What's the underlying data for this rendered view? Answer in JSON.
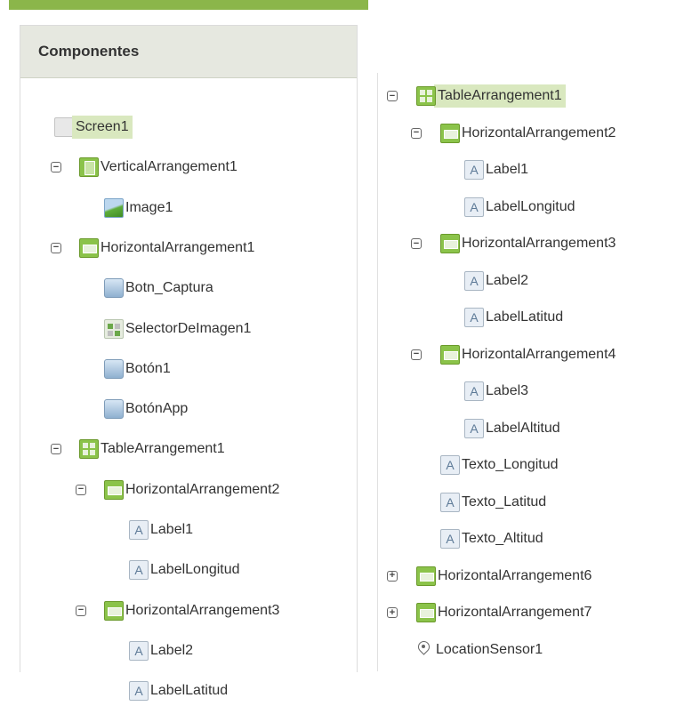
{
  "header": {
    "title": "Componentes"
  },
  "left_tree": [
    {
      "label": "Screen1",
      "icon": "screen-icon",
      "indent": 0,
      "toggle": "",
      "selected": true
    },
    {
      "label": "VerticalArrangement1",
      "icon": "vertical-arrangement-icon",
      "indent": 1,
      "toggle": "−"
    },
    {
      "label": "Image1",
      "icon": "image-icon",
      "indent": 2,
      "toggle": ""
    },
    {
      "label": "HorizontalArrangement1",
      "icon": "horizontal-arrangement-icon",
      "indent": 1,
      "toggle": "−"
    },
    {
      "label": "Botn_Captura",
      "icon": "button-icon",
      "indent": 2,
      "toggle": ""
    },
    {
      "label": "SelectorDeImagen1",
      "icon": "image-picker-icon",
      "indent": 2,
      "toggle": ""
    },
    {
      "label": "Botón1",
      "icon": "button-icon",
      "indent": 2,
      "toggle": ""
    },
    {
      "label": "BotónApp",
      "icon": "button-icon",
      "indent": 2,
      "toggle": ""
    },
    {
      "label": "TableArrangement1",
      "icon": "table-arrangement-icon",
      "indent": 1,
      "toggle": "−"
    },
    {
      "label": "HorizontalArrangement2",
      "icon": "horizontal-arrangement-icon",
      "indent": 2,
      "toggle": "−"
    },
    {
      "label": "Label1",
      "icon": "label-icon",
      "indent": 3,
      "toggle": ""
    },
    {
      "label": "LabelLongitud",
      "icon": "label-icon",
      "indent": 3,
      "toggle": ""
    },
    {
      "label": "HorizontalArrangement3",
      "icon": "horizontal-arrangement-icon",
      "indent": 2,
      "toggle": "−"
    },
    {
      "label": "Label2",
      "icon": "label-icon",
      "indent": 3,
      "toggle": ""
    },
    {
      "label": "LabelLatitud",
      "icon": "label-icon",
      "indent": 3,
      "toggle": ""
    }
  ],
  "right_tree": [
    {
      "label": "TableArrangement1",
      "icon": "table-arrangement-icon",
      "indent": 0,
      "toggle": "−",
      "selected": true
    },
    {
      "label": "HorizontalArrangement2",
      "icon": "horizontal-arrangement-icon",
      "indent": 1,
      "toggle": "−"
    },
    {
      "label": "Label1",
      "icon": "label-icon",
      "indent": 2,
      "toggle": ""
    },
    {
      "label": "LabelLongitud",
      "icon": "label-icon",
      "indent": 2,
      "toggle": ""
    },
    {
      "label": "HorizontalArrangement3",
      "icon": "horizontal-arrangement-icon",
      "indent": 1,
      "toggle": "−"
    },
    {
      "label": "Label2",
      "icon": "label-icon",
      "indent": 2,
      "toggle": ""
    },
    {
      "label": "LabelLatitud",
      "icon": "label-icon",
      "indent": 2,
      "toggle": ""
    },
    {
      "label": "HorizontalArrangement4",
      "icon": "horizontal-arrangement-icon",
      "indent": 1,
      "toggle": "−"
    },
    {
      "label": "Label3",
      "icon": "label-icon",
      "indent": 2,
      "toggle": ""
    },
    {
      "label": "LabelAltitud",
      "icon": "label-icon",
      "indent": 2,
      "toggle": ""
    },
    {
      "label": "Texto_Longitud",
      "icon": "label-icon",
      "indent": 1,
      "toggle": ""
    },
    {
      "label": "Texto_Latitud",
      "icon": "label-icon",
      "indent": 1,
      "toggle": ""
    },
    {
      "label": "Texto_Altitud",
      "icon": "label-icon",
      "indent": 1,
      "toggle": ""
    },
    {
      "label": "HorizontalArrangement6",
      "icon": "horizontal-arrangement-icon",
      "indent": 0,
      "toggle": "+"
    },
    {
      "label": "HorizontalArrangement7",
      "icon": "horizontal-arrangement-icon",
      "indent": 0,
      "toggle": "+"
    },
    {
      "label": "LocationSensor1",
      "icon": "location-pin-icon",
      "indent": 0,
      "toggle": ""
    }
  ],
  "colors": {
    "accent": "#8bb64a",
    "selected": "#d9e8bf",
    "header_bg": "#e6e8e0"
  }
}
